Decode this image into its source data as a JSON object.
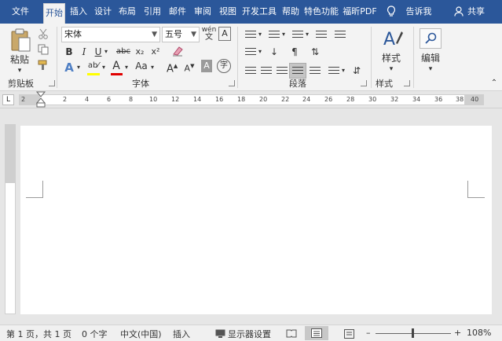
{
  "tabs": [
    {
      "label": "文件"
    },
    {
      "label": "开始"
    },
    {
      "label": "插入"
    },
    {
      "label": "设计"
    },
    {
      "label": "布局"
    },
    {
      "label": "引用"
    },
    {
      "label": "邮件"
    },
    {
      "label": "审阅"
    },
    {
      "label": "视图"
    },
    {
      "label": "开发工具"
    },
    {
      "label": "帮助"
    },
    {
      "label": "特色功能"
    },
    {
      "label": "福昕PDF"
    }
  ],
  "tellme": "告诉我",
  "share": "共享",
  "clipboard": {
    "paste": "粘贴",
    "group": "剪贴板"
  },
  "font": {
    "name": "宋体",
    "size": "五号",
    "group": "字体",
    "bold": "B",
    "italic": "I",
    "underline": "U",
    "strike": "abc",
    "sub": "x₂",
    "sup": "x²",
    "wen": "wén",
    "grow": "A",
    "shrink": "A",
    "case": "Aa",
    "color_a": "A"
  },
  "paragraph": {
    "group": "段落"
  },
  "styles": {
    "label": "样式",
    "group": "样式"
  },
  "editing": {
    "label": "编辑"
  },
  "ruler": {
    "marks": [
      "2",
      "2",
      "4",
      "6",
      "8",
      "10",
      "12",
      "14",
      "16",
      "18",
      "20",
      "22",
      "24",
      "26",
      "28",
      "30",
      "32",
      "34",
      "36",
      "38",
      "40"
    ],
    "tab_selector": "L"
  },
  "status": {
    "page": "第 1 页，共 1 页",
    "words": "0 个字",
    "lang": "中文(中国)",
    "mode": "插入",
    "display": "显示器设置",
    "zoom": "108%"
  },
  "colors": {
    "accent": "#2b579a",
    "highlight": "#ffff00",
    "font_color": "#e00000"
  }
}
